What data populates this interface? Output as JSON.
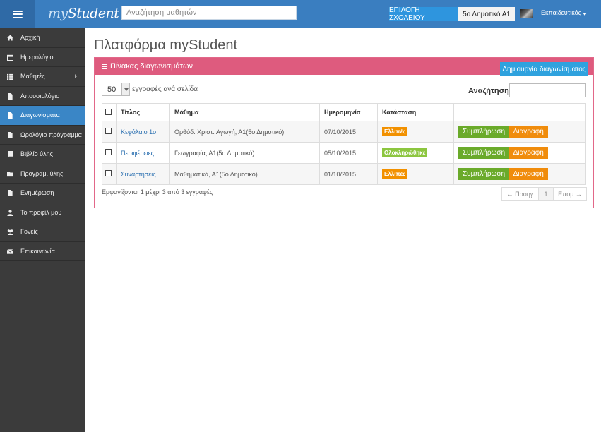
{
  "header": {
    "logo_my": "my",
    "logo_student": "Student",
    "search_placeholder": "Αναζήτηση μαθητών",
    "school_button": "ΕΠΙΛΟΓΗ ΣΧΟΛΕΙΟΥ",
    "class_button": "5ο Δημοτικό Α1",
    "user_name": "Εκπαιδευτικός"
  },
  "sidebar": {
    "items": [
      {
        "label": "Αρχική",
        "icon": "home-icon"
      },
      {
        "label": "Ημερολόγιο",
        "icon": "calendar-icon"
      },
      {
        "label": "Μαθητές",
        "icon": "list-icon"
      },
      {
        "label": "Απουσιολόγιο",
        "icon": "file-icon"
      },
      {
        "label": "Διαγωνίσματα",
        "icon": "file-icon"
      },
      {
        "label": "Ωρολόγιο πρόγραμμα",
        "icon": "file-icon"
      },
      {
        "label": "Βιβλίο ύλης",
        "icon": "book-icon"
      },
      {
        "label": "Προγραμ. ύλης",
        "icon": "folder-icon"
      },
      {
        "label": "Ενημέρωση",
        "icon": "file-icon"
      },
      {
        "label": "Το προφίλ μου",
        "icon": "user-icon"
      },
      {
        "label": "Γονείς",
        "icon": "users-icon"
      },
      {
        "label": "Επικοινωνία",
        "icon": "envelope-icon"
      }
    ],
    "active_index": 4
  },
  "main": {
    "page_title": "Πλατφόρμα myStudent",
    "panel_title": "Πίνακας διαγωνισμάτων",
    "create_button": "Δημιουργία διαγωνίσματος",
    "page_length": "50",
    "page_length_label": "εγγραφές ανά σελίδα",
    "search_label": "Αναζήτηση:",
    "columns": [
      "Τίτλος",
      "Μάθημα",
      "Ημερομηνία",
      "Κατάσταση"
    ],
    "rows": [
      {
        "title": "Κεφάλαιο 1ο",
        "course": "Ορθόδ. Χριστ. Αγωγή, Α1(5ο Δημοτικό)",
        "date": "07/10/2015",
        "status": "Ελλιπές",
        "status_color": "#f29100"
      },
      {
        "title": "Περιφέρειες",
        "course": "Γεωγραφία, Α1(5ο Δημοτικό)",
        "date": "05/10/2015",
        "status": "Ολοκληρώθηκε",
        "status_color": "#8cc63f"
      },
      {
        "title": "Συναρτήσεις",
        "course": "Μαθηματικά, Α1(5ο Δημοτικό)",
        "date": "01/10/2015",
        "status": "Ελλιπές",
        "status_color": "#f29100"
      }
    ],
    "complete_button": "Συμπλήρωση",
    "delete_button": "Διαγραφή",
    "info_text": "Εμφανίζονται 1 μέχρι 3 από 3 εγγραφές",
    "pager": {
      "prev": "← Προηγ",
      "page": "1",
      "next": "Επομ →"
    }
  },
  "colors": {
    "topbar": "#3a7ec0",
    "sidebar": "#3b3b3b",
    "active": "#3a86c6",
    "panel_header": "#de5b7e",
    "success": "#6aaa2a",
    "warning": "#f08c0c"
  }
}
